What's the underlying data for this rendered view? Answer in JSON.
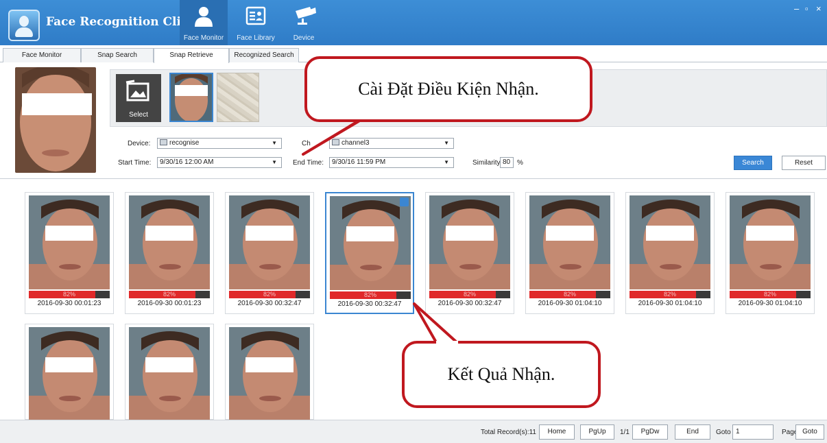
{
  "app": {
    "title": "Face Recognition Client",
    "nav": [
      {
        "label": "Face Monitor",
        "icon": "person-icon"
      },
      {
        "label": "Face Library",
        "icon": "id-card-icon"
      },
      {
        "label": "Device",
        "icon": "camera-icon"
      }
    ],
    "window_controls": [
      "–",
      "▫",
      "×"
    ]
  },
  "tabs": [
    "Face Monitor",
    "Snap Search",
    "Snap Retrieve",
    "Recognized Search"
  ],
  "active_tab": "Snap Retrieve",
  "query": {
    "select_label": "Select",
    "device_label": "Device:",
    "device_value": "recognise",
    "channel_label": "Ch",
    "channel_value": "channel3",
    "start_label": "Start Time:",
    "start_value": "9/30/16 12:00 AM",
    "end_label": "End Time:",
    "end_value": "9/30/16 11:59 PM",
    "similarity_label": "Similarity:",
    "similarity_value": "80",
    "similarity_unit": "%",
    "search_label": "Search",
    "reset_label": "Reset"
  },
  "results": {
    "row1": [
      {
        "score": "82%",
        "score_value": 0.82,
        "time": "2016-09-30 00:01:23"
      },
      {
        "score": "82%",
        "score_value": 0.82,
        "time": "2016-09-30 00:01:23"
      },
      {
        "score": "82%",
        "score_value": 0.82,
        "time": "2016-09-30 00:32:47"
      },
      {
        "score": "82%",
        "score_value": 0.82,
        "time": "2016-09-30 00:32:47"
      },
      {
        "score": "82%",
        "score_value": 0.82,
        "time": "2016-09-30 00:32:47"
      },
      {
        "score": "82%",
        "score_value": 0.82,
        "time": "2016-09-30 01:04:10"
      },
      {
        "score": "82%",
        "score_value": 0.82,
        "time": "2016-09-30 01:04:10"
      },
      {
        "score": "82%",
        "score_value": 0.82,
        "time": "2016-09-30 01:04:10"
      }
    ],
    "row2_count": 3
  },
  "footer": {
    "total": "Total Record(s):11",
    "home": "Home",
    "pgup": "PgUp",
    "page_info": "1/1",
    "pgdw": "PgDw",
    "end": "End",
    "goto_label": "Goto",
    "goto_value": "1",
    "page_label": "Page",
    "goto_button": "Goto"
  },
  "callouts": {
    "top": "Cài Đặt Điều Kiện Nhận.",
    "bottom": "Kết Quả Nhận."
  },
  "colors": {
    "titlebar": "#2f7cc7",
    "accent": "#3a87d6",
    "score_fill": "#e0292a",
    "callout_border": "#c0181f"
  }
}
